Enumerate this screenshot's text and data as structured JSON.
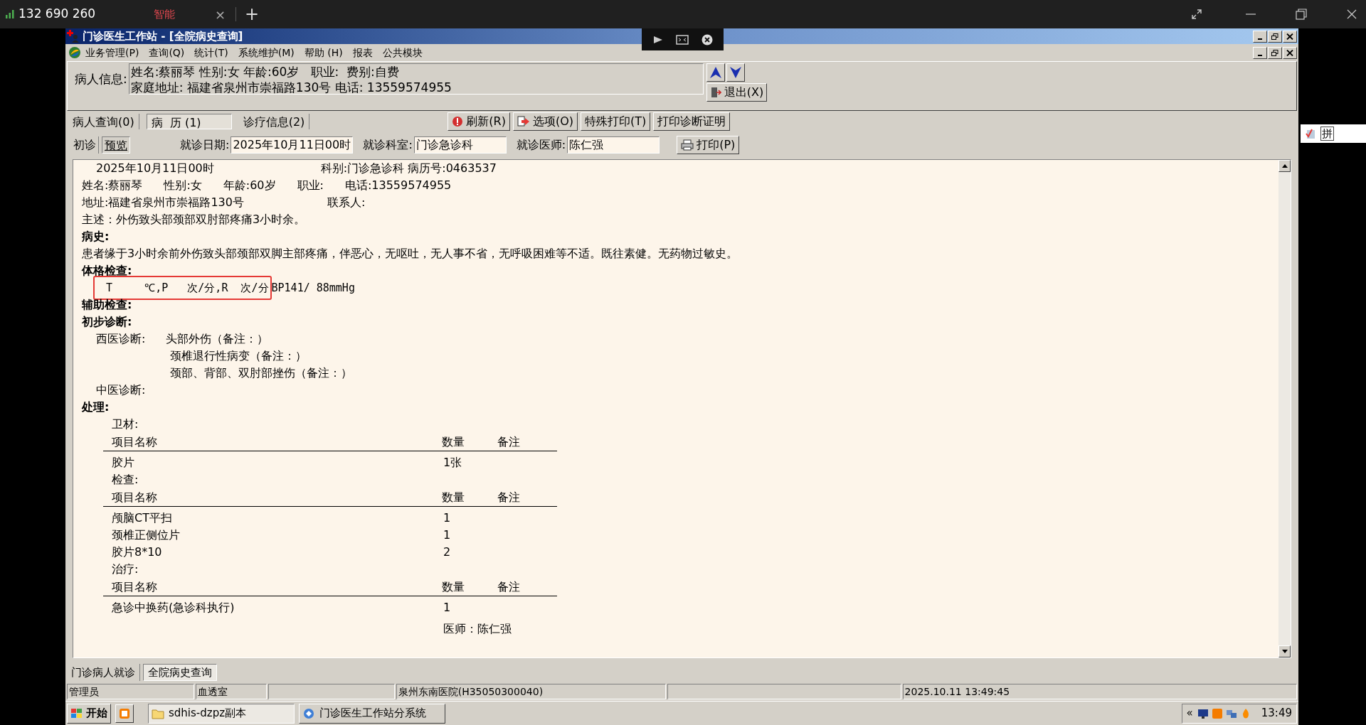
{
  "top_bar": {
    "stats": "132 690 260",
    "tab": {
      "label": "智能",
      "close": "×"
    },
    "new_tab": "+"
  },
  "window": {
    "title": "门诊医生工作站 - [全院病史查询]"
  },
  "menu": [
    "业务管理(P)",
    "查询(Q)",
    "统计(T)",
    "系统维护(M)",
    "帮助 (H)",
    "报表",
    "公共模块"
  ],
  "patient_info": {
    "label": "病人信息:",
    "line1": "姓名:蔡丽琴 性别:女 年龄:60岁   职业:  费别:自费",
    "line2": "家庭地址: 福建省泉州市崇福路130号 电话: 13559574955",
    "exit_button": "退出(X)"
  },
  "tabs": [
    {
      "label": "病人查询(0)",
      "selected": false
    },
    {
      "label": "病  历 (1)",
      "selected": true
    },
    {
      "label": "诊疗信息(2)",
      "selected": false
    }
  ],
  "toolbar": [
    {
      "label": "刷新(R)",
      "kind": "refresh"
    },
    {
      "label": "选项(O)",
      "kind": "options"
    },
    {
      "label": "特殊打印(T)",
      "kind": "plain"
    },
    {
      "label": "打印诊断证明",
      "kind": "plain"
    }
  ],
  "subtabs": [
    {
      "label": "初诊",
      "selected": false
    },
    {
      "label": "预览",
      "selected": true
    }
  ],
  "fields": [
    {
      "label": "就诊日期:",
      "value": "2025年10月11日00时"
    },
    {
      "label": "就诊科室:",
      "value": "门诊急诊科"
    },
    {
      "label": "就诊医师:",
      "value": "陈仁强"
    }
  ],
  "print_button": "打印(P)",
  "record": [
    {
      "kind": "header",
      "texts": [
        "2025年10月11日00时",
        "科别:门诊急诊科 病历号:0463537"
      ]
    },
    {
      "kind": "patient",
      "texts": [
        "姓名:蔡丽琴",
        "性别:女",
        "年龄:60岁",
        "职业:",
        "电话:13559574955"
      ]
    },
    {
      "kind": "address",
      "texts": [
        "地址:福建省泉州市崇福路130号",
        "联系人:"
      ]
    },
    {
      "kind": "text",
      "text": "主述：外伤致头部颈部双肘部疼痛3小时余。"
    },
    {
      "kind": "heading",
      "text": "病史:"
    },
    {
      "kind": "text",
      "text": "患者缘于3小时余前外伤致头部颈部双脚主部疼痛，伴恶心，无呕吐，无人事不省，无呼吸困难等不适。既往素健。无药物过敏史。"
    },
    {
      "kind": "heading",
      "text": "体格检查:"
    },
    {
      "kind": "vitals",
      "highlighted": "T     ℃,P   次/分,R  次/分",
      "rest": "BP141/ 88mmHg"
    },
    {
      "kind": "heading",
      "text": "辅助检查:"
    },
    {
      "kind": "heading",
      "text": "初步诊断:"
    },
    {
      "kind": "diagnosis",
      "label": "西医诊断:",
      "items": [
        "头部外伤（备注：）",
        "颈椎退行性病变（备注：）",
        "颈部、背部、双肘部挫伤（备注：）"
      ]
    },
    {
      "kind": "subtext",
      "text": "中医诊断:"
    },
    {
      "kind": "heading",
      "text": "处理:"
    },
    {
      "kind": "table",
      "title": "卫材:",
      "columns": [
        "项目名称",
        "数量",
        "备注"
      ],
      "rows": [
        [
          "胶片",
          "1张"
        ]
      ]
    },
    {
      "kind": "table",
      "title": "检查:",
      "columns": [
        "项目名称",
        "数量",
        "备注"
      ],
      "rows": [
        [
          "颅脑CT平扫",
          "1"
        ],
        [
          "颈椎正侧位片",
          "1"
        ],
        [
          "胶片8*10",
          "2"
        ]
      ]
    },
    {
      "kind": "table",
      "title": "治疗:",
      "columns": [
        "项目名称",
        "数量",
        "备注"
      ],
      "rows": [
        [
          "急诊中换药(急诊科执行)",
          "1"
        ]
      ]
    },
    {
      "kind": "signature",
      "text": "医师：陈仁强"
    }
  ],
  "bottom_tabs": [
    {
      "label": "门诊病人就诊",
      "selected": false
    },
    {
      "label": "全院病史查询",
      "selected": true
    }
  ],
  "status_bar": {
    "user": "管理员",
    "department": "血透室",
    "hospital": "泉州东南医院(H35050300040)",
    "datetime": "2025.10.11 13:49:45"
  },
  "taskbar": {
    "start": "开始",
    "tasks": [
      {
        "label": "sdhis-dzpz副本",
        "selected": true
      },
      {
        "label": "门诊医生工作站分系统",
        "selected": false
      }
    ],
    "tray_toggle": "«",
    "clock": "13:49"
  },
  "ime_bar": {
    "mode": "拼"
  }
}
